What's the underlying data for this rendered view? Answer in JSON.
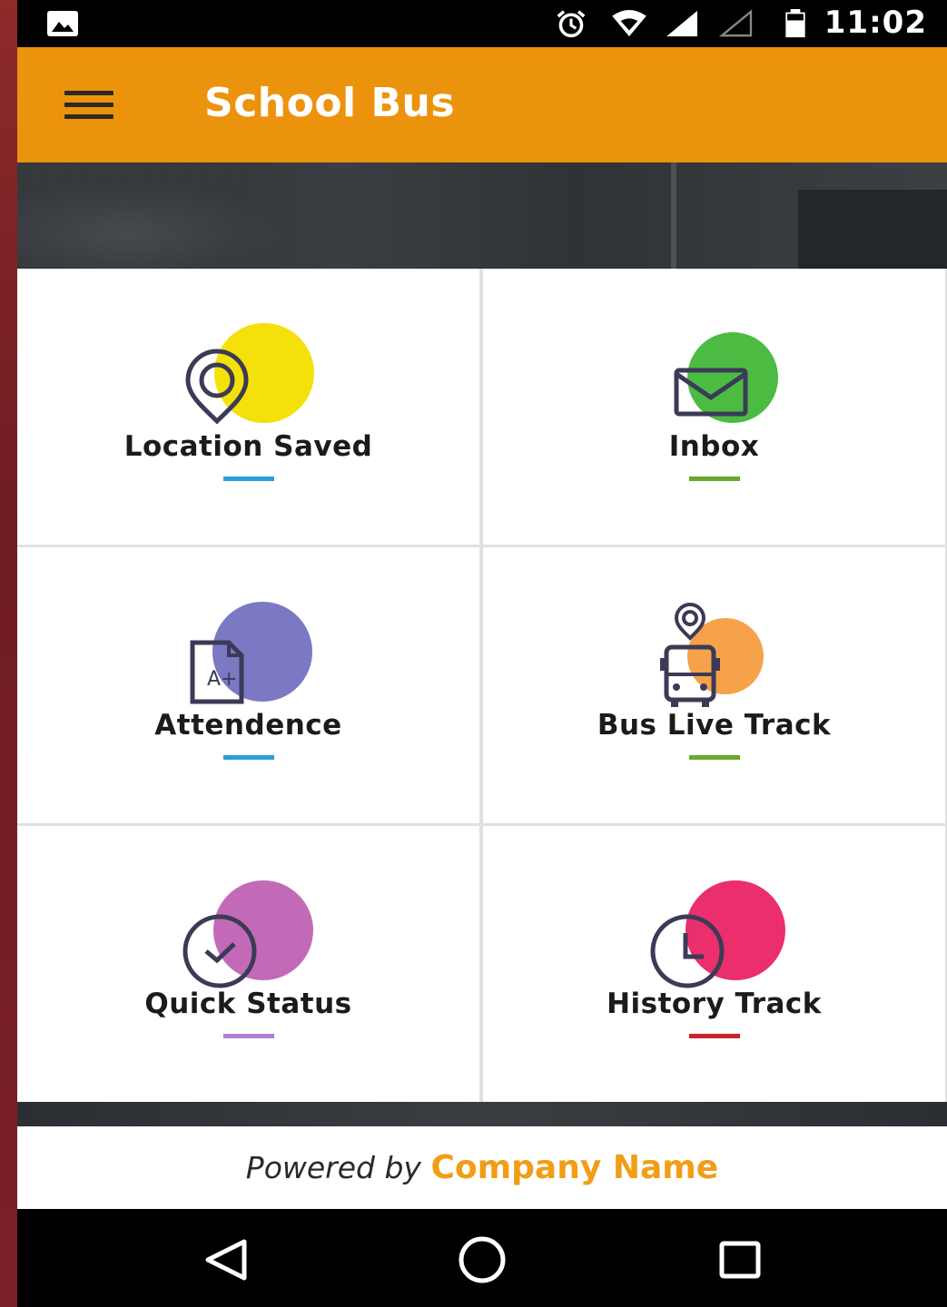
{
  "status_bar": {
    "time": "11:02",
    "icons": [
      "gallery-icon",
      "alarm-icon",
      "wifi-icon",
      "signal-icon",
      "signal-empty-icon",
      "battery-icon"
    ]
  },
  "app_bar": {
    "title": "School Bus",
    "menu_icon": "hamburger-menu-icon"
  },
  "tiles": [
    {
      "label": "Location Saved",
      "icon": "location-pin-icon",
      "accent": "#f5e10a",
      "underline": "#2a9fd6"
    },
    {
      "label": "Inbox",
      "icon": "envelope-icon",
      "accent": "#4cbb42",
      "underline": "#6aa82c"
    },
    {
      "label": "Attendence",
      "icon": "grade-document-icon",
      "accent": "#7b78c4",
      "underline": "#2a9fd6"
    },
    {
      "label": "Bus Live Track",
      "icon": "bus-location-icon",
      "accent": "#f6a24a",
      "underline": "#6aa82c"
    },
    {
      "label": "Quick Status",
      "icon": "check-circle-icon",
      "accent": "#c26ab8",
      "underline": "#b07fd3"
    },
    {
      "label": "History Track",
      "icon": "clock-icon",
      "accent": "#ea2f6c",
      "underline": "#c8232f"
    }
  ],
  "footer": {
    "powered_by": "Powered by",
    "company": "Company Name"
  },
  "nav_bar": {
    "back_icon": "back-triangle-icon",
    "home_icon": "home-circle-icon",
    "recents_icon": "recents-square-icon"
  },
  "colors": {
    "app_bar": "#ec930d",
    "company_text": "#f19d16"
  }
}
